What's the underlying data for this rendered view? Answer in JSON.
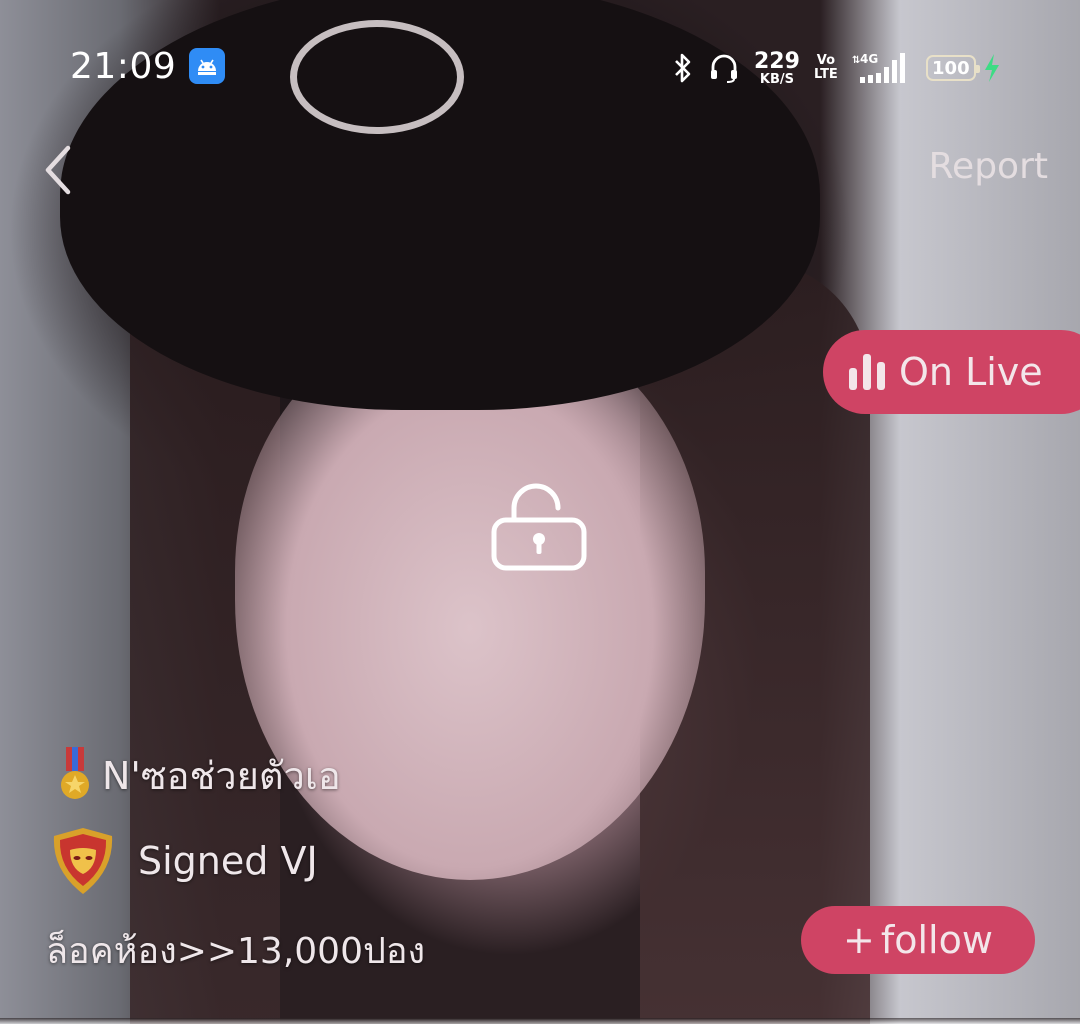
{
  "status_bar": {
    "time": "21:09",
    "android_icon": "android-icon",
    "speed_value": "229",
    "speed_unit": "KB/S",
    "volte_top": "Vo",
    "volte_bottom": "LTE",
    "network": "4G",
    "battery": "100",
    "charging_color": "#3ddc84"
  },
  "header": {
    "back_icon": "chevron-left-icon",
    "report_label": "Report"
  },
  "live_badge": {
    "label": "On Live",
    "color": "#cf4464"
  },
  "center": {
    "lock_icon": "unlock-icon"
  },
  "profile": {
    "name": "N'ซอช่วยตัวเอ",
    "medal_icon": "medal-icon",
    "badge_icon": "shield-mask-icon",
    "role": "Signed VJ",
    "room_lock_price": "ล็อคห้อง>>13,000ปอง"
  },
  "follow_button": {
    "plus": "+",
    "label": "follow",
    "color": "#cf4464"
  }
}
